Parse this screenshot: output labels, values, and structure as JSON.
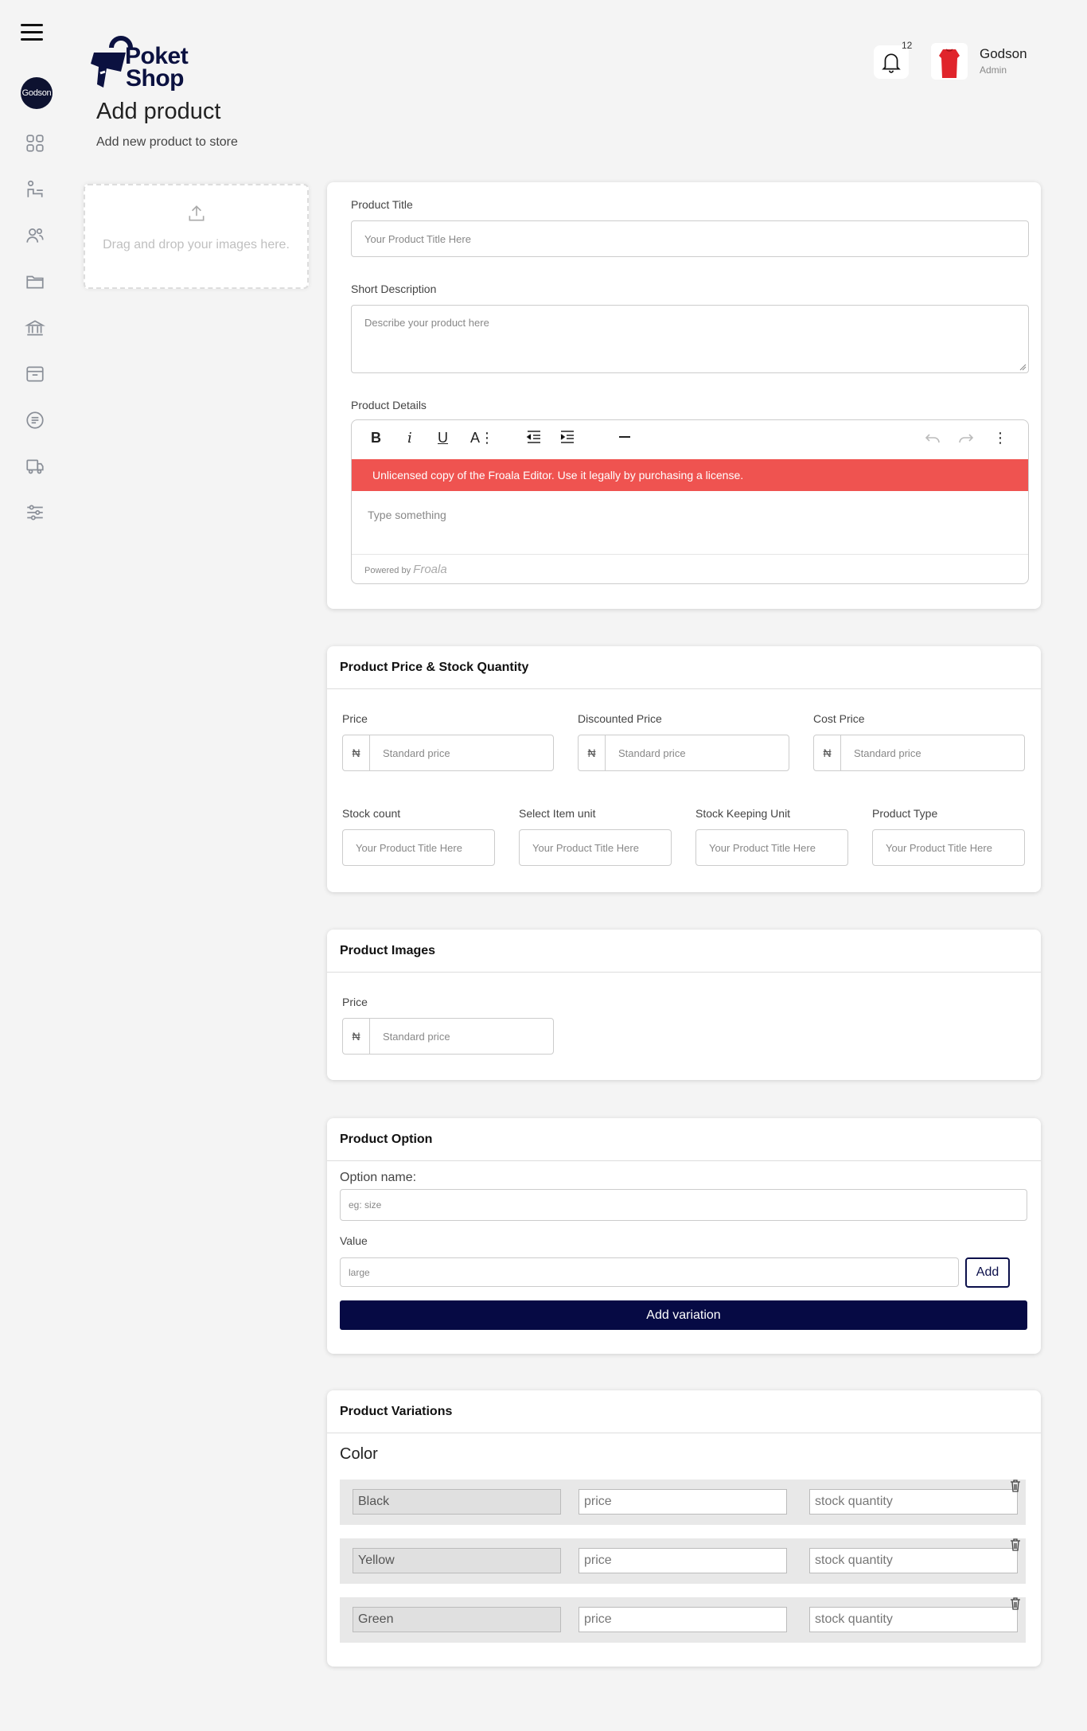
{
  "sidebar": {
    "avatar_label": "Godson"
  },
  "header": {
    "logo_line1": "Poket",
    "logo_line2": "Shop",
    "page_title": "Add product",
    "page_subtitle": "Add new product to store",
    "notification_count": "12",
    "user_name": "Godson",
    "user_role": "Admin"
  },
  "dropzone": {
    "text": "Drag and drop your images here."
  },
  "basic": {
    "title_label": "Product Title",
    "title_placeholder": "Your Product Title Here",
    "desc_label": "Short Description",
    "desc_placeholder": "Describe your product here",
    "details_label": "Product Details",
    "editor_warning": "Unlicensed copy of the Froala Editor. Use it legally by purchasing a license.",
    "editor_placeholder": "Type something",
    "editor_powered": "Powered by",
    "editor_brand": "Froala"
  },
  "pricing": {
    "heading": "Product Price & Stock Quantity",
    "currency": "₦",
    "price_label": "Price",
    "discounted_label": "Discounted Price",
    "cost_label": "Cost Price",
    "price_placeholder": "Standard price",
    "stock_label": "Stock count",
    "unit_label": "Select Item unit",
    "sku_label": "Stock Keeping Unit",
    "type_label": "Product Type",
    "title_placeholder": "Your Product Title Here"
  },
  "images": {
    "heading": "Product Images",
    "price_label": "Price",
    "currency": "₦",
    "price_placeholder": "Standard price"
  },
  "option": {
    "heading": "Product Option",
    "name_label": "Option name:",
    "name_placeholder": "eg: size",
    "value_label": "Value",
    "value_placeholder": "large",
    "add_label": "Add",
    "variation_label": "Add variation"
  },
  "variations": {
    "heading": "Product Variations",
    "group": "Color",
    "price_placeholder": "price",
    "stock_placeholder": "stock quantity",
    "rows": [
      {
        "name": "Black"
      },
      {
        "name": "Yellow"
      },
      {
        "name": "Green"
      }
    ]
  }
}
